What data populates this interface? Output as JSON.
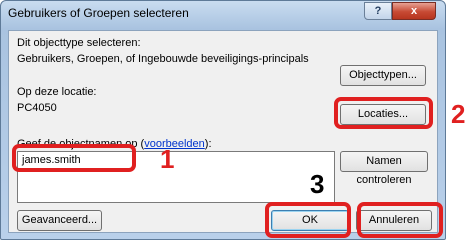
{
  "dialog": {
    "title": "Gebruikers of Groepen selecteren",
    "help_glyph": "?",
    "close_glyph": "x"
  },
  "object_type": {
    "label": "Dit objecttype selecteren:",
    "value": "Gebruikers, Groepen, of Ingebouwde beveiligings-principals",
    "button": "Objecttypen..."
  },
  "location": {
    "label": "Op deze locatie:",
    "value": "PC4050",
    "button": "Locaties..."
  },
  "names": {
    "label_prefix": "Geef de objectnamen op",
    "link": "voorbeelden",
    "label_suffix": "):",
    "value": "james.smith",
    "check_button": "Namen controleren"
  },
  "buttons": {
    "advanced": "Geavanceerd...",
    "ok": "OK",
    "cancel": "Annuleren"
  },
  "callouts": {
    "step1": "1",
    "step2": "2",
    "step3": "3",
    "color": "#e02020"
  }
}
